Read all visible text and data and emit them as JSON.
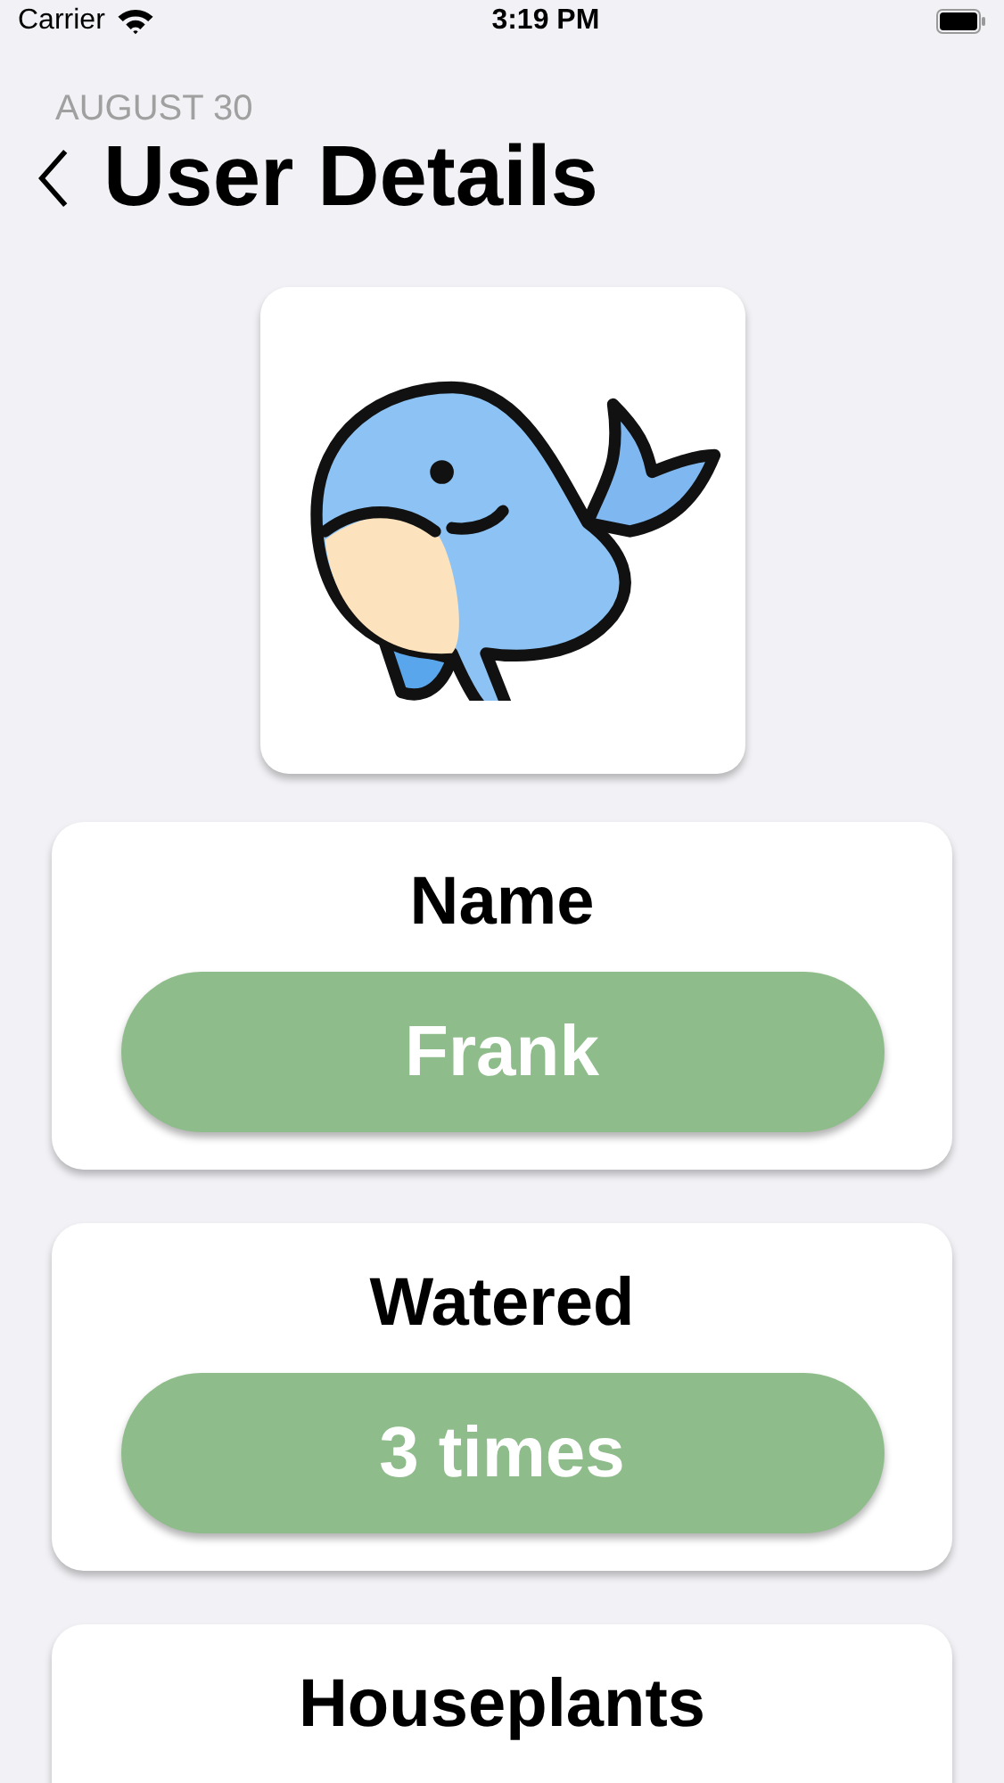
{
  "status_bar": {
    "carrier": "Carrier",
    "time": "3:19 PM"
  },
  "header": {
    "date": "AUGUST 30",
    "title": "User Details"
  },
  "fields": [
    {
      "label": "Name",
      "value": "Frank"
    },
    {
      "label": "Watered",
      "value": "3 times"
    },
    {
      "label": "Houseplants"
    }
  ]
}
